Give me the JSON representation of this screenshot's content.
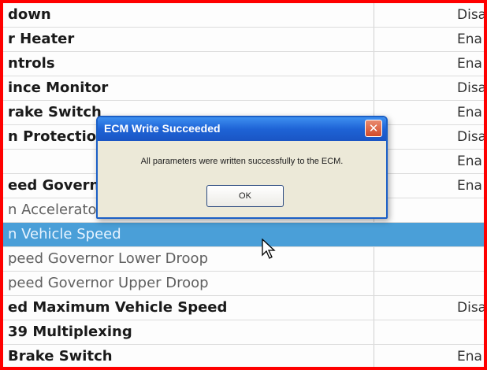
{
  "table": {
    "rows": [
      {
        "name": "down",
        "value": "Disa",
        "style": "bold"
      },
      {
        "name": "r Heater",
        "value": "Ena",
        "style": "bold"
      },
      {
        "name": "ntrols",
        "value": "Ena",
        "style": "bold"
      },
      {
        "name": "ince Monitor",
        "value": "Disa",
        "style": "bold"
      },
      {
        "name": "rake Switch",
        "value": "Ena",
        "style": "bold"
      },
      {
        "name": "n Protectio",
        "value": "Disa",
        "style": "bold"
      },
      {
        "name": "",
        "value": "Ena",
        "style": "bold"
      },
      {
        "name": "eed Governo",
        "value": "Ena",
        "style": "bold"
      },
      {
        "name": "n Accelerato",
        "value": "",
        "style": "light"
      },
      {
        "name": "n Vehicle Speed",
        "value": "",
        "style": "light",
        "selected": true
      },
      {
        "name": "peed Governor Lower Droop",
        "value": "",
        "style": "light"
      },
      {
        "name": "peed Governor Upper Droop",
        "value": "",
        "style": "light"
      },
      {
        "name": "ed Maximum Vehicle Speed",
        "value": "Disa",
        "style": "bold"
      },
      {
        "name": "39 Multiplexing",
        "value": "",
        "style": "bold"
      },
      {
        "name": "Brake Switch",
        "value": "Ena",
        "style": "bold"
      }
    ]
  },
  "dialog": {
    "title": "ECM Write Succeeded",
    "close_label": "✕",
    "message": "All parameters were written successfully to the ECM.",
    "ok_label": "OK"
  },
  "colors": {
    "frame": "#ff0000",
    "selection": "#4a9fd8",
    "dialog_title": "#1e63d6"
  }
}
